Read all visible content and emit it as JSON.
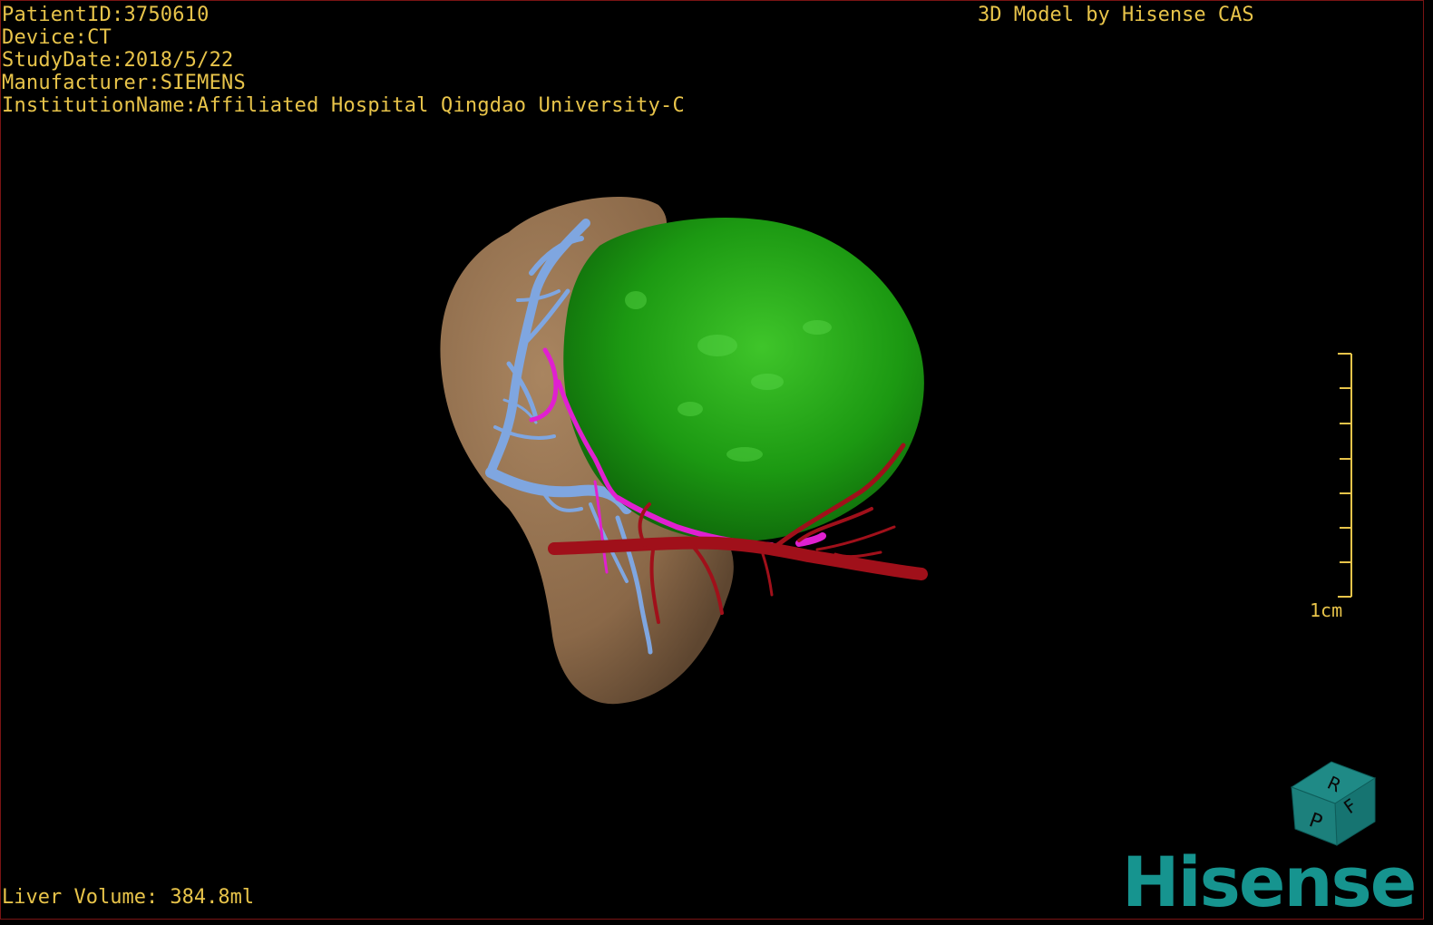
{
  "header": {
    "patient_id": "PatientID:3750610",
    "device": "Device:CT",
    "study_date": "StudyDate:2018/5/22",
    "manufacturer": "Manufacturer:SIEMENS",
    "institution": "InstitutionName:Affiliated Hospital Qingdao University-C",
    "brand_text": "3D Model by Hisense CAS"
  },
  "footer": {
    "liver_volume": "Liver Volume: 384.8ml"
  },
  "scale_bar": {
    "label": "1cm"
  },
  "orientation_cube": {
    "face_top": "R",
    "face_right": "F",
    "face_left": "P"
  },
  "logo": {
    "text": "Hisense"
  },
  "colors": {
    "overlay_text": "#e8c44a",
    "liver": "#9a7654",
    "tumor": "#1f9a14",
    "portal_vein": "#7fa6e0",
    "artery": "#a0101a",
    "bile_duct": "#e020d0",
    "logo": "#16948f"
  }
}
